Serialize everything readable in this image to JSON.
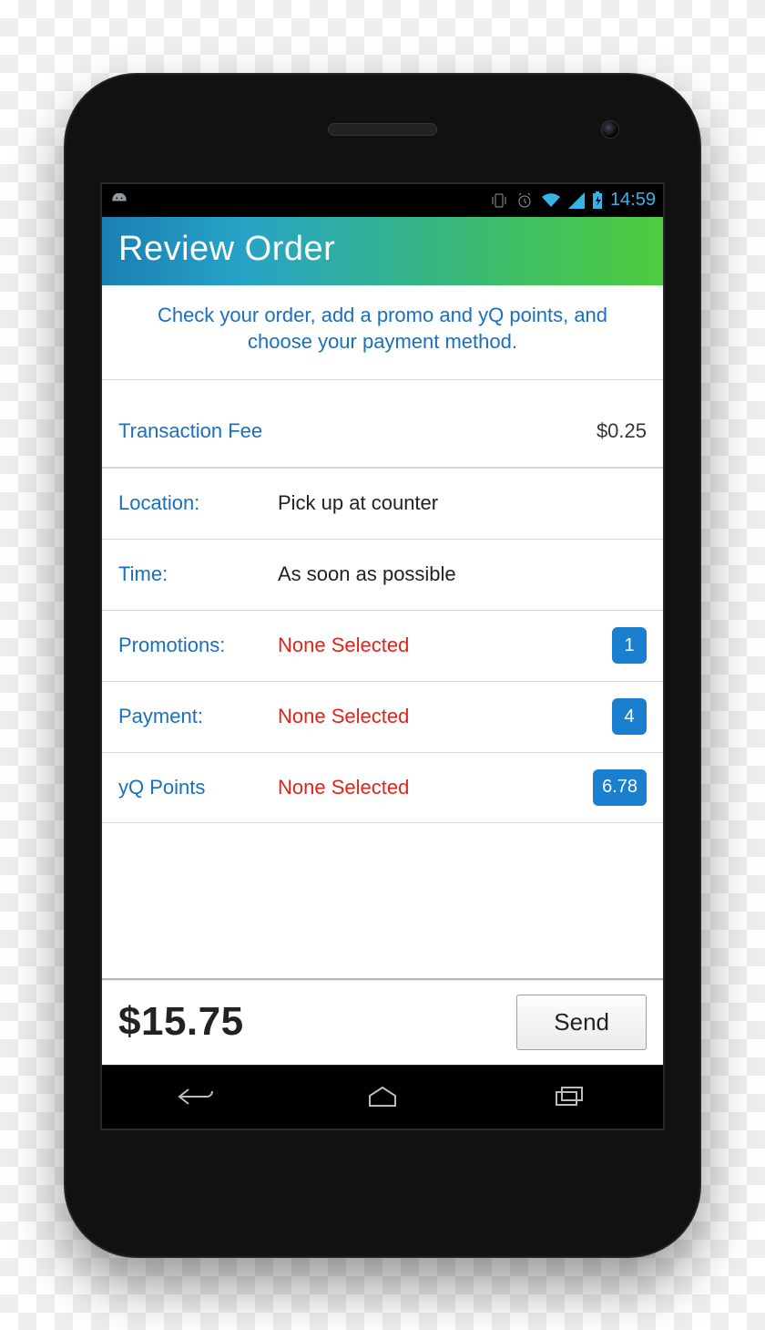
{
  "statusbar": {
    "time": "14:59"
  },
  "titlebar": {
    "title": "Review Order"
  },
  "instructions": "Check your order, add a promo and yQ points, and choose your payment method.",
  "rows": {
    "fee": {
      "label": "Transaction Fee",
      "value": "$0.25"
    },
    "location": {
      "label": "Location:",
      "value": "Pick up at counter"
    },
    "time": {
      "label": "Time:",
      "value": "As soon as possible"
    },
    "promotions": {
      "label": "Promotions:",
      "value": "None Selected",
      "badge": "1"
    },
    "payment": {
      "label": "Payment:",
      "value": "None Selected",
      "badge": "4"
    },
    "points": {
      "label": "yQ Points",
      "value": "None Selected",
      "badge": "6.78"
    }
  },
  "footer": {
    "total": "$15.75",
    "send": "Send"
  }
}
